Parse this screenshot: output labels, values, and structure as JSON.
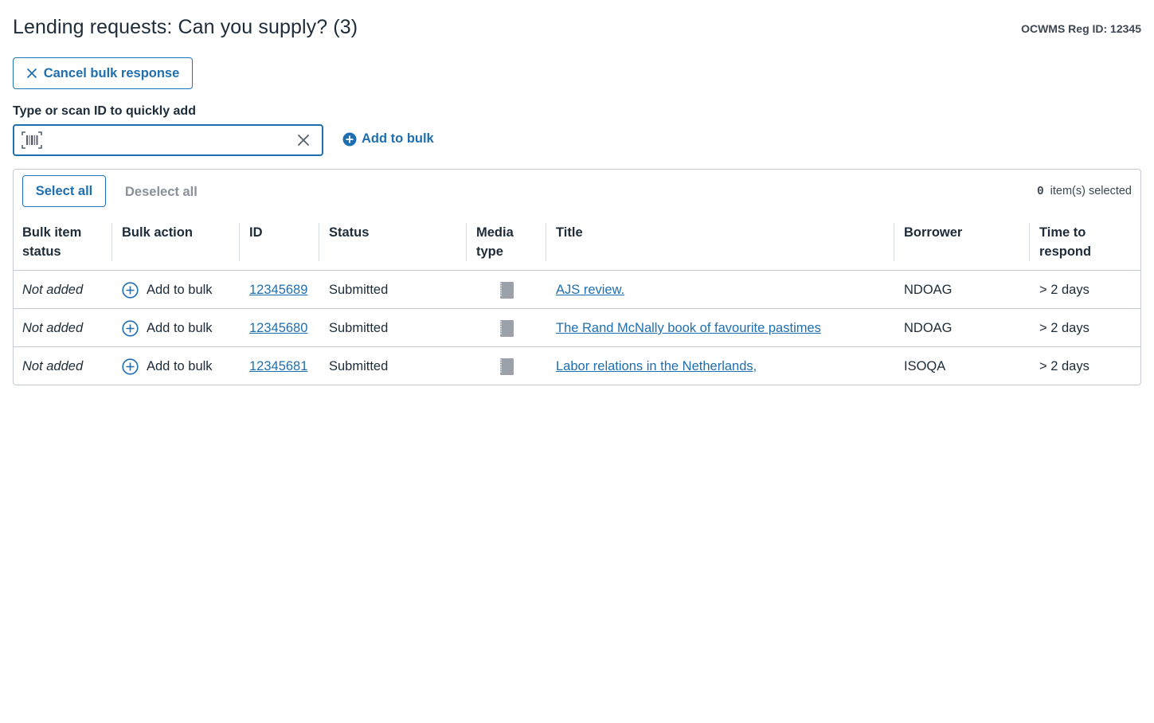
{
  "header": {
    "title": "Lending requests: Can you supply? (3)",
    "reg_id": "OCWMS Reg ID: 12345"
  },
  "actions": {
    "cancel_bulk_label": "Cancel bulk response",
    "quick_add_label": "Type or scan ID to quickly add",
    "quick_add_value": "",
    "add_to_bulk_label": "Add to bulk"
  },
  "panel": {
    "select_all_label": "Select all",
    "deselect_all_label": "Deselect all",
    "selected_count": "0",
    "selected_suffix": "item(s) selected"
  },
  "table": {
    "columns": [
      [
        "Bulk item",
        "status"
      ],
      [
        "Bulk action"
      ],
      [
        "ID"
      ],
      [
        "Status"
      ],
      [
        "Media",
        "type"
      ],
      [
        "Title"
      ],
      [
        "Borrower"
      ],
      [
        "Time to",
        "respond"
      ]
    ],
    "rows": [
      {
        "bulk_status": "Not added",
        "bulk_action": "Add to bulk",
        "id": "12345689",
        "status": "Submitted",
        "media_icon": "book-icon",
        "title": "AJS review.",
        "borrower": "NDOAG",
        "time": "> 2 days"
      },
      {
        "bulk_status": "Not added",
        "bulk_action": "Add to bulk",
        "id": "12345680",
        "status": "Submitted",
        "media_icon": "book-icon",
        "title": "The Rand McNally book of favourite pastimes",
        "borrower": "NDOAG",
        "time": "> 2 days"
      },
      {
        "bulk_status": "Not added",
        "bulk_action": "Add to bulk",
        "id": "12345681",
        "status": "Submitted",
        "media_icon": "book-icon",
        "title": "Labor relations in the Netherlands,",
        "borrower": "ISOQA",
        "time": "> 2 days"
      }
    ]
  },
  "colors": {
    "accent": "#1f6fb0",
    "text": "#1e2b38",
    "muted": "#8a9098",
    "border": "#c5cbd1"
  }
}
